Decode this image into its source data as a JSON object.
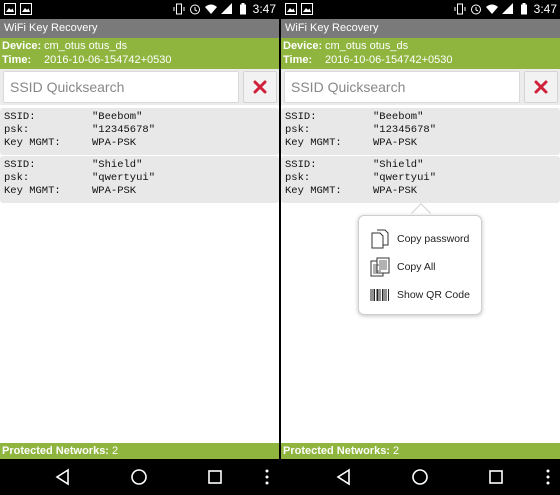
{
  "app": {
    "title": "WiFi Key Recovery",
    "device_label": "Device:",
    "device_value": "cm_otus otus_ds",
    "time_label": "Time:",
    "time_value": "2016-10-06-154742+0530"
  },
  "statusbar": {
    "time": "3:47"
  },
  "search": {
    "placeholder": "SSID Quicksearch"
  },
  "networks": [
    {
      "ssid_label": "SSID:",
      "ssid": "\"Beebom\"",
      "psk_label": "psk:",
      "psk": "\"12345678\"",
      "mgmt_label": "Key MGMT:",
      "mgmt": "WPA-PSK"
    },
    {
      "ssid_label": "SSID:",
      "ssid": "\"Shield\"",
      "psk_label": "psk:",
      "psk": "\"qwertyui\"",
      "mgmt_label": "Key MGMT:",
      "mgmt": "WPA-PSK"
    }
  ],
  "popup_menu": {
    "items": [
      {
        "label": "Copy password",
        "icon": "copy-document-icon"
      },
      {
        "label": "Copy All",
        "icon": "copy-all-icon"
      },
      {
        "label": "Show QR Code",
        "icon": "barcode-icon"
      }
    ]
  },
  "footer": {
    "label": "Protected Networks:",
    "count": "2"
  },
  "colors": {
    "accent": "#8fb53f",
    "titlebar": "#7a7a7a",
    "clear_x": "#d0213a",
    "card": "#e8e8e8"
  }
}
